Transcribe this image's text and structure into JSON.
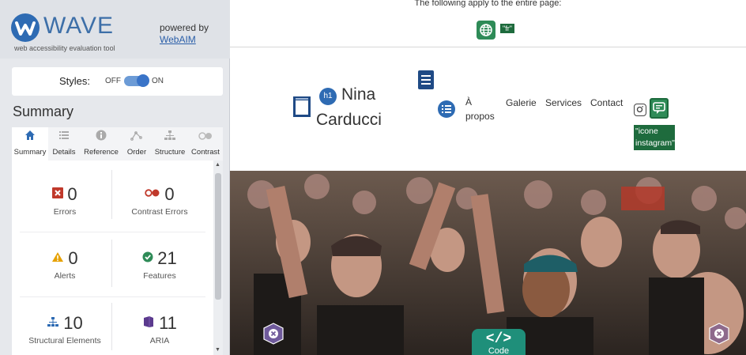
{
  "wave": {
    "logo": "WAVE",
    "subtitle": "web accessibility evaluation tool",
    "powered_by": "powered by",
    "webaim_link": "WebAIM",
    "styles_label": "Styles:",
    "styles_off": "OFF",
    "styles_on": "ON",
    "styles_enabled": true,
    "summary_heading": "Summary",
    "tabs": [
      {
        "label": "Summary",
        "icon": "home-icon",
        "active": true
      },
      {
        "label": "Details",
        "icon": "list-icon",
        "active": false
      },
      {
        "label": "Reference",
        "icon": "info-icon",
        "active": false
      },
      {
        "label": "Order",
        "icon": "order-icon",
        "active": false
      },
      {
        "label": "Structure",
        "icon": "structure-icon",
        "active": false
      },
      {
        "label": "Contrast",
        "icon": "contrast-icon",
        "active": false
      }
    ],
    "stats": {
      "errors": {
        "value": "0",
        "label": "Errors"
      },
      "contrast_errors": {
        "value": "0",
        "label": "Contrast Errors"
      },
      "alerts": {
        "value": "0",
        "label": "Alerts"
      },
      "features": {
        "value": "21",
        "label": "Features"
      },
      "structural": {
        "value": "10",
        "label": "Structural Elements"
      },
      "aria": {
        "value": "11",
        "label": "ARIA"
      }
    },
    "colors": {
      "accent": "#2e6bb3",
      "error": "#c0392b",
      "alert": "#e6a100",
      "feature": "#2e8b57",
      "aria": "#5b3a8e"
    }
  },
  "page": {
    "top_note": "The following apply to the entire page:",
    "lang_tag": "\"fr\"",
    "site_name_line1": "Nina",
    "site_name_line2": "Carducci",
    "h1_badge": "h1",
    "nav": {
      "a_propos_1": "À",
      "a_propos_2": "propos",
      "galerie": "Galerie",
      "services": "Services",
      "contact": "Contact"
    },
    "alt_tag": "\"icone instagram\"",
    "code_label": "Code",
    "code_glyph": "</>"
  }
}
